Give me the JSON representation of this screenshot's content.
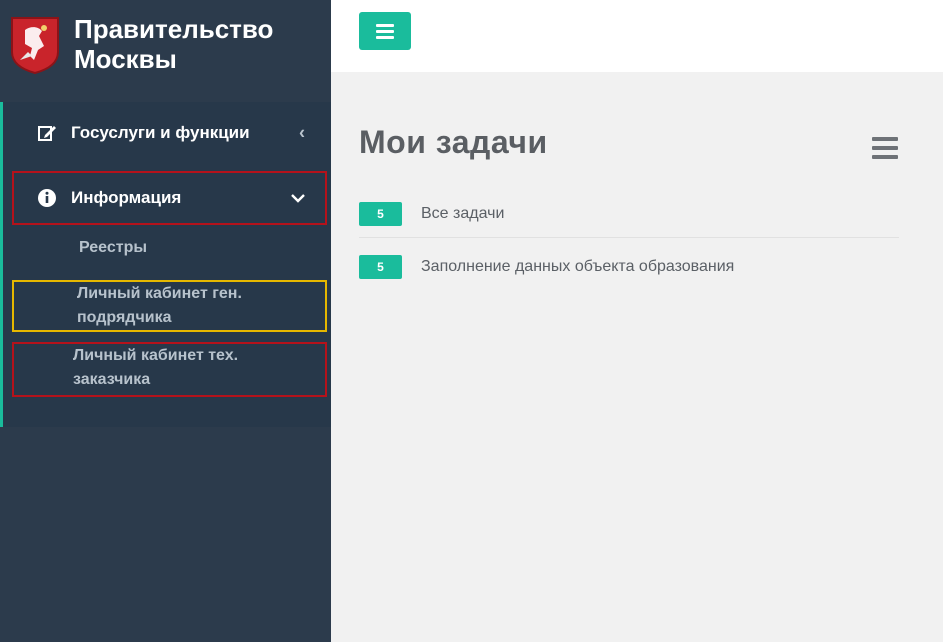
{
  "brand": {
    "title": "Правительство Москвы",
    "logo_icon": "moscow-coat-of-arms-icon"
  },
  "topbar": {
    "toggle_icon": "hamburger-icon"
  },
  "sidebar": {
    "items": [
      {
        "label": "Госуслуги и функции",
        "icon": "edit-icon",
        "chevron": "‹"
      },
      {
        "label": "Информация",
        "icon": "info-icon",
        "chevron": "⌄"
      }
    ],
    "subitems": [
      {
        "label": "Реестры"
      },
      {
        "label": "Личный кабинет ген. подрядчика"
      },
      {
        "label": "Личный кабинет тех. заказчика"
      }
    ]
  },
  "main": {
    "title": "Мои задачи",
    "tasks": [
      {
        "count": "5",
        "label": "Все задачи"
      },
      {
        "count": "5",
        "label": "Заполнение данных объекта образования"
      }
    ]
  },
  "colors": {
    "accent": "#1abc9c",
    "sidebar": "#2c3b4c",
    "highlight_red": "#b5121b",
    "highlight_yellow": "#e6b800"
  }
}
